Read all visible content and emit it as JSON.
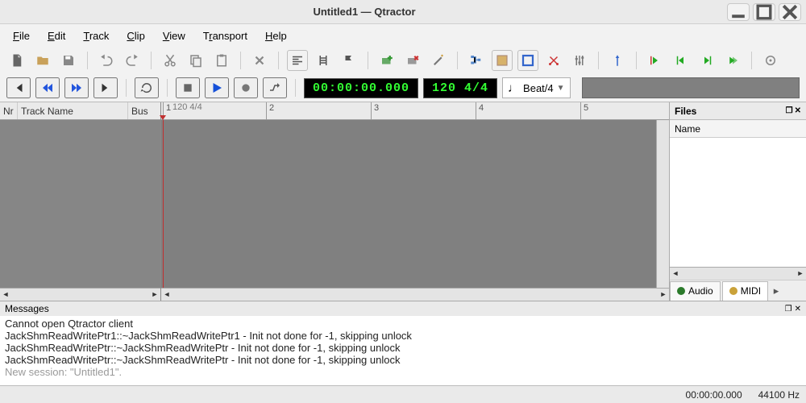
{
  "window": {
    "title": "Untitled1 — Qtractor"
  },
  "menus": [
    "File",
    "Edit",
    "Track",
    "Clip",
    "View",
    "Transport",
    "Help"
  ],
  "transport": {
    "time": "00:00:00.000",
    "tempo": "120 4/4",
    "beat_label": "Beat/4"
  },
  "tracklist": {
    "col_nr": "Nr",
    "col_name": "Track Name",
    "col_bus": "Bus"
  },
  "ruler": {
    "tempo_label": "120 4/4",
    "marks": [
      "1",
      "2",
      "3",
      "4",
      "5"
    ]
  },
  "files": {
    "title": "Files",
    "col_name": "Name",
    "tab_audio": "Audio",
    "tab_midi": "MIDI"
  },
  "messages": {
    "title": "Messages",
    "lines": [
      "Cannot open Qtractor client",
      "JackShmReadWritePtr1::~JackShmReadWritePtr1 - Init not done for -1, skipping unlock",
      "JackShmReadWritePtr::~JackShmReadWritePtr - Init not done for -1, skipping unlock",
      "JackShmReadWritePtr::~JackShmReadWritePtr - Init not done for -1, skipping unlock"
    ],
    "muted": "New session: \"Untitled1\"."
  },
  "status": {
    "time": "00:00:00.000",
    "rate": "44100 Hz"
  },
  "icons": {
    "note": "♩"
  }
}
